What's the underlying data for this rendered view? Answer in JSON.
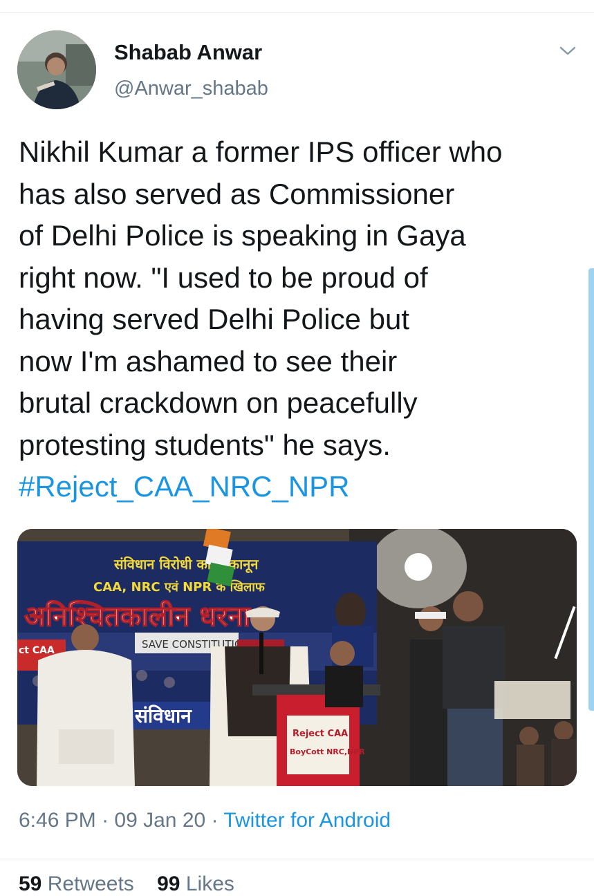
{
  "author": {
    "display_name": "Shabab Anwar",
    "handle": "@Anwar_shabab"
  },
  "tweet": {
    "text_lines": [
      "Nikhil Kumar a former IPS officer who",
      "has also served as Commissioner",
      "of Delhi Police is speaking in Gaya",
      "right now. \"I used to be proud of",
      "having served Delhi Police but",
      "now I'm ashamed to see their",
      "brutal crackdown on peaceful​ly",
      "protesting students\" he says."
    ],
    "hashtag": "#Reject_CAA_NRC_NPR"
  },
  "media": {
    "banner_line1": "संविधान विरोधी काला कानून",
    "banner_line2": "CAA, NRC एवं NPR के खिलाफ",
    "banner_big": "अनिश्चितकालीन धरना",
    "save_text": "SAVE CONSTITUTION",
    "left_tag": "ct CAA",
    "podium_line1": "Reject CAA",
    "podium_line2": "BoyCott NRC,NPR",
    "bottom_strip": "संविधान"
  },
  "meta": {
    "time": "6:46 PM",
    "date": "09 Jan 20",
    "source": "Twitter for Android",
    "separator": " · "
  },
  "stats": {
    "retweets_count": "59",
    "retweets_label": "Retweets",
    "likes_count": "99",
    "likes_label": "Likes"
  },
  "colors": {
    "link": "#1b95e0",
    "secondary": "#657786",
    "primary": "#14171a"
  },
  "icons": {
    "menu": "chevron-down-icon"
  }
}
